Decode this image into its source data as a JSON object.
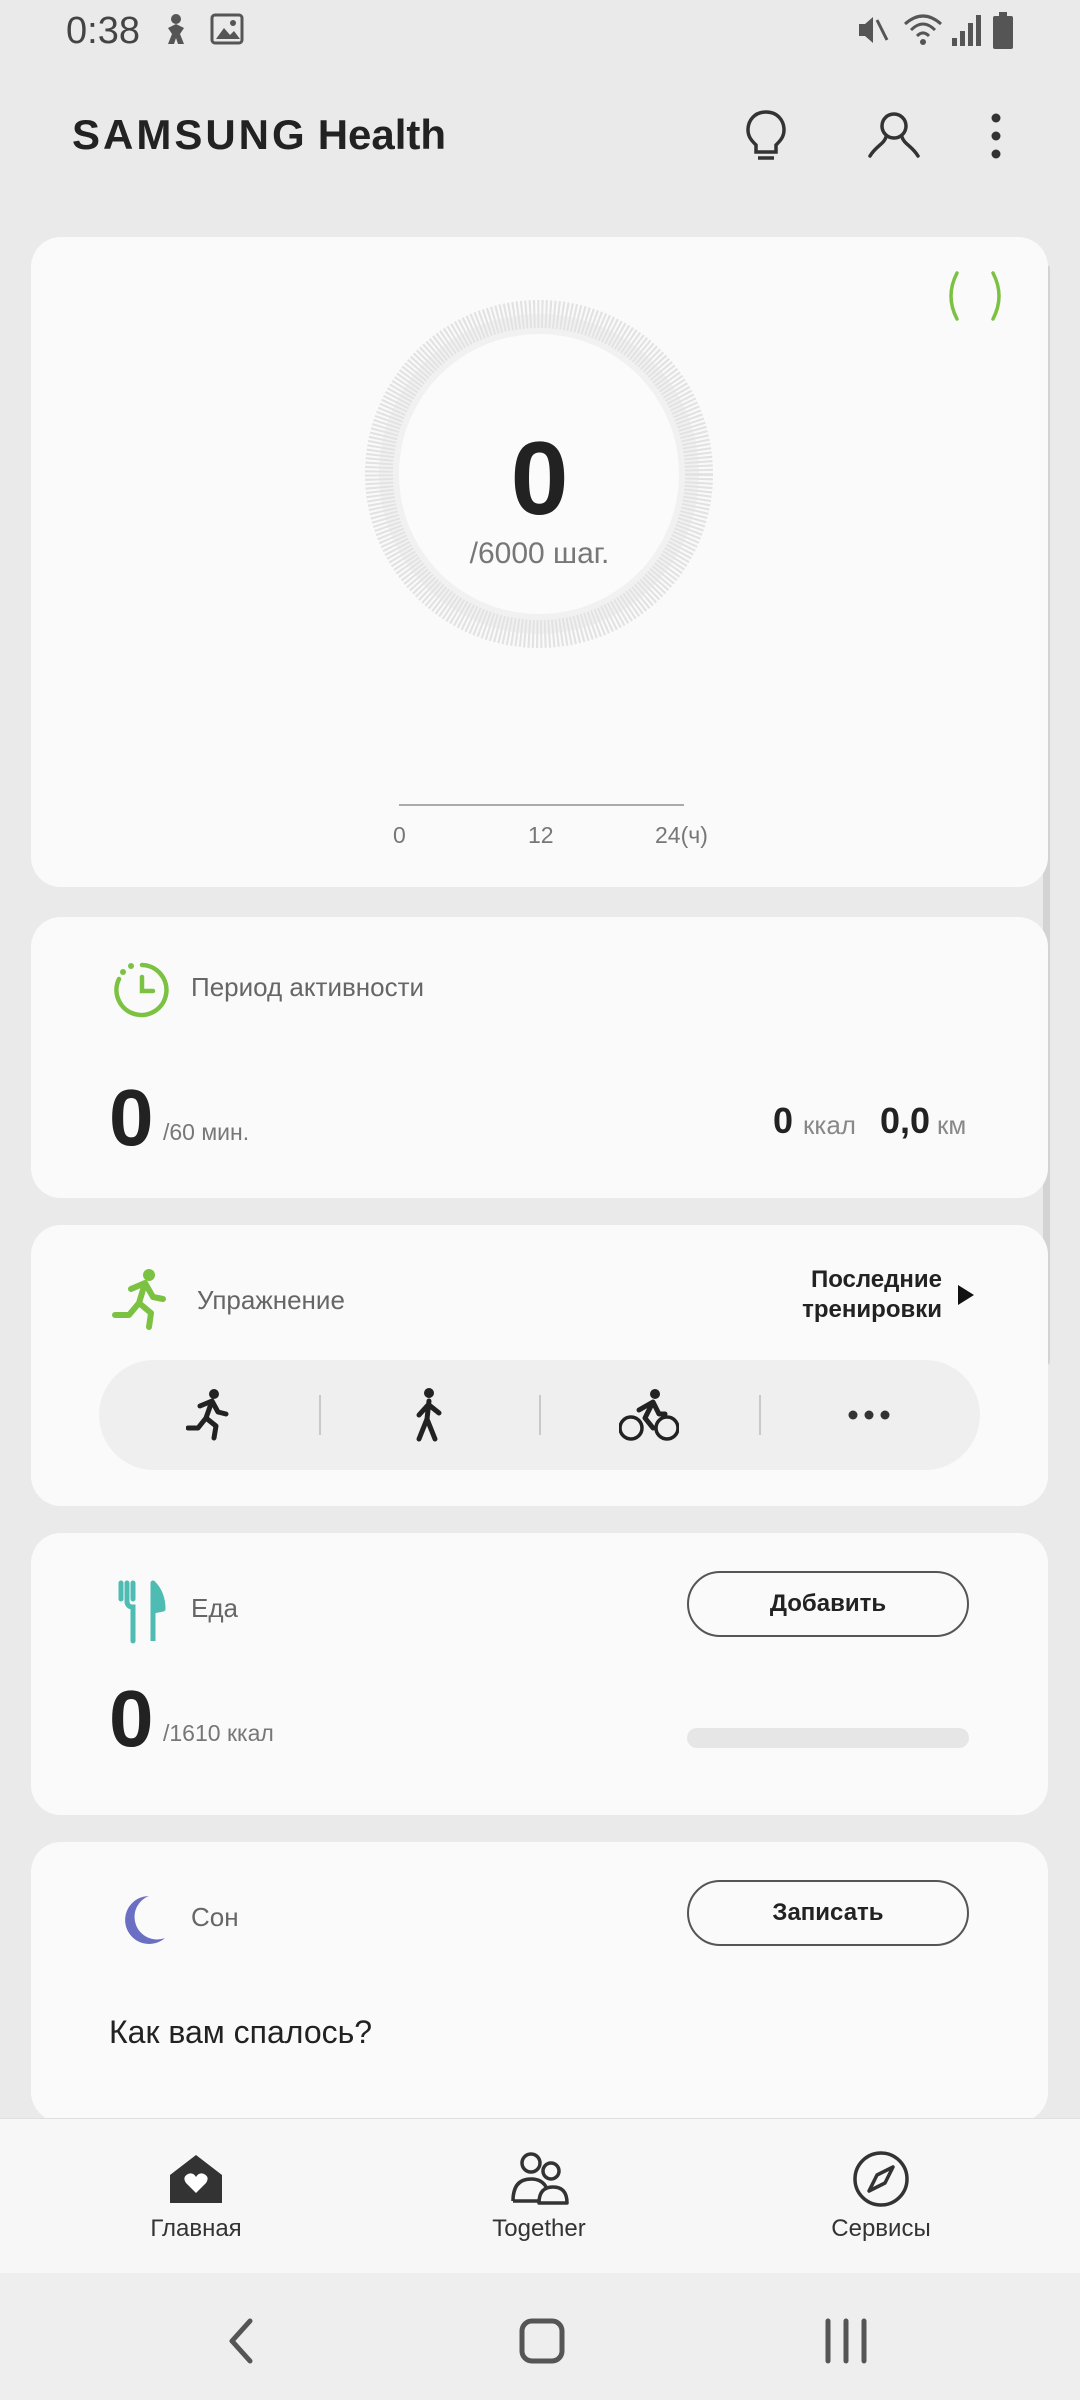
{
  "status_bar": {
    "time": "0:38",
    "icons": [
      "location-person-icon",
      "image-icon",
      "mute-icon",
      "wifi-icon",
      "signal-icon",
      "battery-icon"
    ]
  },
  "header": {
    "brand_word": "SAMSUNG",
    "app_word": "Health",
    "actions": [
      "lightbulb-icon",
      "profile-icon",
      "more-icon"
    ]
  },
  "steps": {
    "value": "0",
    "goal": "/6000 шаг.",
    "axis_ticks": [
      "0",
      "12",
      "24(ч)"
    ],
    "accent_color": "#7cc242"
  },
  "activity": {
    "title": "Период активности",
    "value": "0",
    "goal": "/60 мин.",
    "kcal_value": "0",
    "kcal_unit": "ккал",
    "km_value": "0,0",
    "km_unit": "км",
    "icon_color": "#7cc242"
  },
  "exercise": {
    "title": "Упражнение",
    "last_workouts_line1": "Последние",
    "last_workouts_line2": "тренировки",
    "types": [
      "running-icon",
      "walking-icon",
      "cycling-icon",
      "more-dots-icon"
    ],
    "icon_color": "#7cc242"
  },
  "food": {
    "title": "Еда",
    "add_label": "Добавить",
    "value": "0",
    "goal": "/1610 ккал",
    "progress": 0,
    "icon_color": "#4fbcb3"
  },
  "sleep": {
    "title": "Сон",
    "record_label": "Записать",
    "question": "Как вам спалось?",
    "icon_color": "#6a6fc4"
  },
  "bottom_nav": {
    "items": [
      {
        "label": "Главная",
        "icon": "home-heart-icon"
      },
      {
        "label": "Together",
        "icon": "people-icon"
      },
      {
        "label": "Сервисы",
        "icon": "compass-icon"
      }
    ]
  },
  "system_nav": [
    "back-icon",
    "home-icon",
    "recents-icon"
  ]
}
